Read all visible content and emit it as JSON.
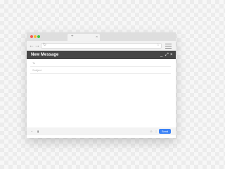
{
  "browser": {
    "tab_close_glyph": "×",
    "new_tab_glyph": "+",
    "back_glyph": "←",
    "forward_glyph": "→",
    "reload_glyph": "↻",
    "star_glyph": "☆",
    "traffic_lights": [
      "#f45b52",
      "#fcb833",
      "#3fc549"
    ]
  },
  "compose": {
    "title": "New Message",
    "minimize_glyph": "_",
    "expand_glyph": "⤢",
    "close_glyph": "×",
    "to_placeholder": "To",
    "subject_placeholder": "Subject",
    "header_color": "#454545"
  },
  "footer": {
    "attach_glyph": "+",
    "clip_glyph": "▮",
    "emoji_glyph": "☺",
    "more_glyph": "⋮",
    "send_label": "Send",
    "send_color": "#3b82f6"
  }
}
